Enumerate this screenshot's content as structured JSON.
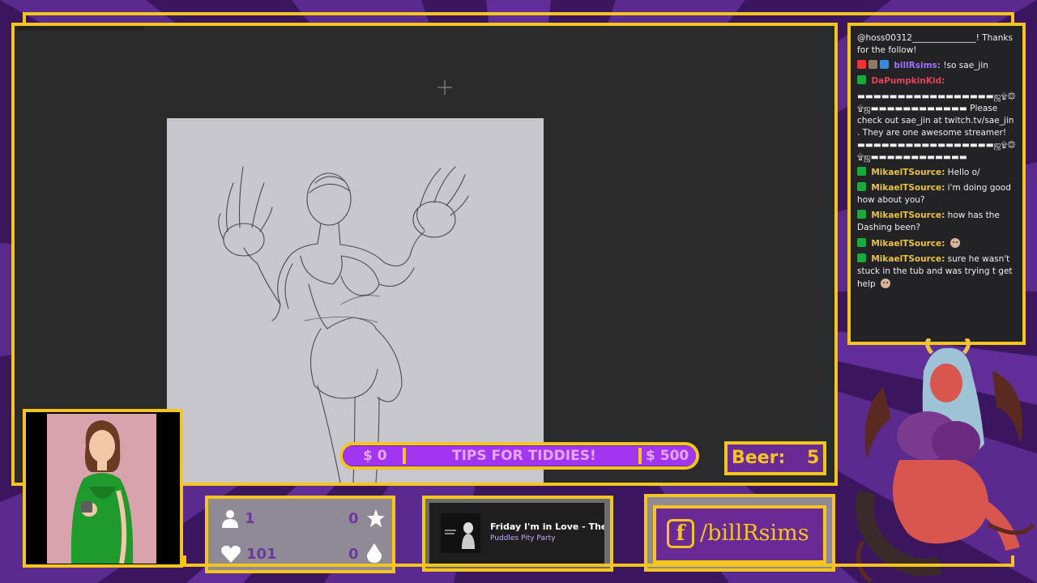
{
  "overlay": {
    "colors": {
      "accent": "#f4c51c",
      "purple": "#6a2a96",
      "bright_purple": "#a236f0"
    }
  },
  "tips": {
    "min_label": "$ 0",
    "label": "TIPS FOR TIDDIES!",
    "max_label": "$ 500",
    "progress": 0
  },
  "beer": {
    "label": "Beer:",
    "count": "5"
  },
  "stats": {
    "followers": "1",
    "hearts": "101",
    "favorites": "0",
    "gems": "0",
    "icons": [
      "person-icon",
      "star-icon",
      "heart-icon",
      "gem-icon"
    ]
  },
  "music": {
    "title": "Friday I'm in Love - The Bo",
    "artist": "Puddles Pity Party"
  },
  "social": {
    "handle": "/billRsims",
    "icon": "facebook-icon"
  },
  "chat": {
    "messages": [
      {
        "user": "",
        "text": "@hoss00312_______________! Thanks for the follow!"
      },
      {
        "user": "billRsims",
        "text": "!so sae_jin"
      },
      {
        "user": "DaPumpkinKid",
        "text": ""
      },
      {
        "user": "",
        "text": "▬▬▬▬▬▬▬▬▬▬▬▬▬▬▬▬▬ஜ۩۞۩ஜ▬▬▬▬▬▬▬▬▬▬▬▬ Please check out sae_jin at twitch.tv/sae_jin . They are one awesome streamer! ▬▬▬▬▬▬▬▬▬▬▬▬▬▬▬▬▬ஜ۩۞۩ஜ▬▬▬▬▬▬▬▬▬▬▬▬"
      },
      {
        "user": "MikaelTSource",
        "text": "Hello o/"
      },
      {
        "user": "MikaelTSource",
        "text": "i'm doing good how about you?"
      },
      {
        "user": "MikaelTSource",
        "text": "how has the Dashing been?"
      },
      {
        "user": "MikaelTSource",
        "text": ""
      },
      {
        "user": "MikaelTSource",
        "text": "sure he wasn't stuck in the tub and was trying t get help"
      }
    ]
  }
}
